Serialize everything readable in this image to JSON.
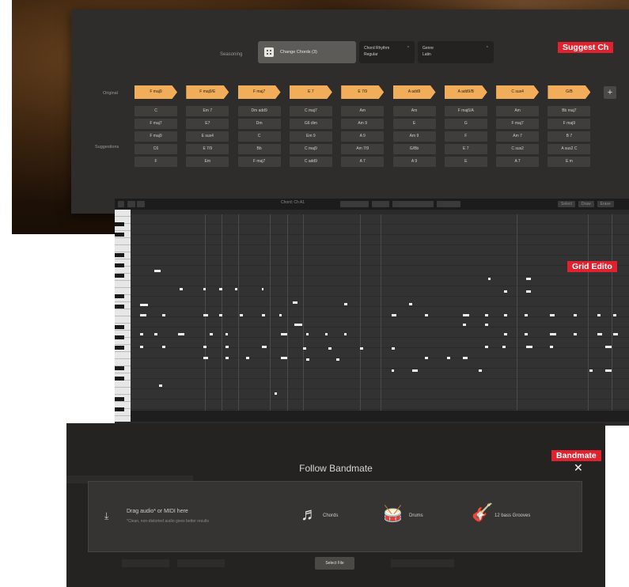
{
  "section_tags": {
    "suggest": "Suggest Ch",
    "grid": "Grid Edito",
    "bandmate": "Bandmate"
  },
  "chords_panel": {
    "toolbar": {
      "seasoning_label": "Seasoning",
      "change_button": "Change Chords (3)",
      "rhythm_label": "Chord Rhythm",
      "rhythm_value": "Regular",
      "genre_label": "Genre",
      "genre_value": "Latin"
    },
    "original_label": "Original",
    "suggestions_label": "Suggestions",
    "columns": [
      {
        "original": "F maj9",
        "suggestions": [
          "C",
          "F maj7",
          "F maj9",
          "C6",
          "F"
        ]
      },
      {
        "original": "F maj9/E",
        "suggestions": [
          "Em 7",
          "E7",
          "E sus4",
          "E 7/9",
          "Em"
        ]
      },
      {
        "original": "F maj7",
        "suggestions": [
          "Dm add9",
          "Dm",
          "C",
          "Bb",
          "F maj7"
        ]
      },
      {
        "original": "E 7",
        "suggestions": [
          "C maj7",
          "G6 dim",
          "Em 9",
          "C maj9",
          "C add9"
        ]
      },
      {
        "original": "E 7/9",
        "suggestions": [
          "Am",
          "Am 9",
          "A 9",
          "Am 7/9",
          "A 7"
        ]
      },
      {
        "original": "A add9",
        "suggestions": [
          "Am",
          "E",
          "Am 9",
          "G/Bb",
          "A 9"
        ]
      },
      {
        "original": "A add9/B",
        "suggestions": [
          "F maj6/A",
          "G",
          "F",
          "E 7",
          "E"
        ]
      },
      {
        "original": "C sus4",
        "suggestions": [
          "Am",
          "F maj7",
          "Am 7",
          "C sus2",
          "A 7"
        ]
      },
      {
        "original": "G/B",
        "suggestions": [
          "Bb maj7",
          "F maj9",
          "B 7",
          "A sus2 C",
          "E m"
        ]
      }
    ],
    "add_label": "+"
  },
  "grid_editor": {
    "toolbar_center": "Chord: Ch A1",
    "toolbar_right": [
      "Select",
      "Draw",
      "Erase"
    ]
  },
  "bandmate_panel": {
    "title": "Follow Bandmate",
    "close": "✕",
    "drop_title": "Drag audio* or MIDI here",
    "drop_sub": "*Clean, non-distorted audio gives better results",
    "options": [
      {
        "icon": "chords-icon",
        "label": "Chords"
      },
      {
        "icon": "drums-icon",
        "label": "Drums"
      },
      {
        "icon": "guitar-icon",
        "label": "12 bass Grooves"
      }
    ],
    "select_file": "Select File"
  },
  "colors": {
    "accent_orange": "#f2ad5a",
    "tag_red": "#e0222e",
    "panel": "#2e2d2b"
  }
}
